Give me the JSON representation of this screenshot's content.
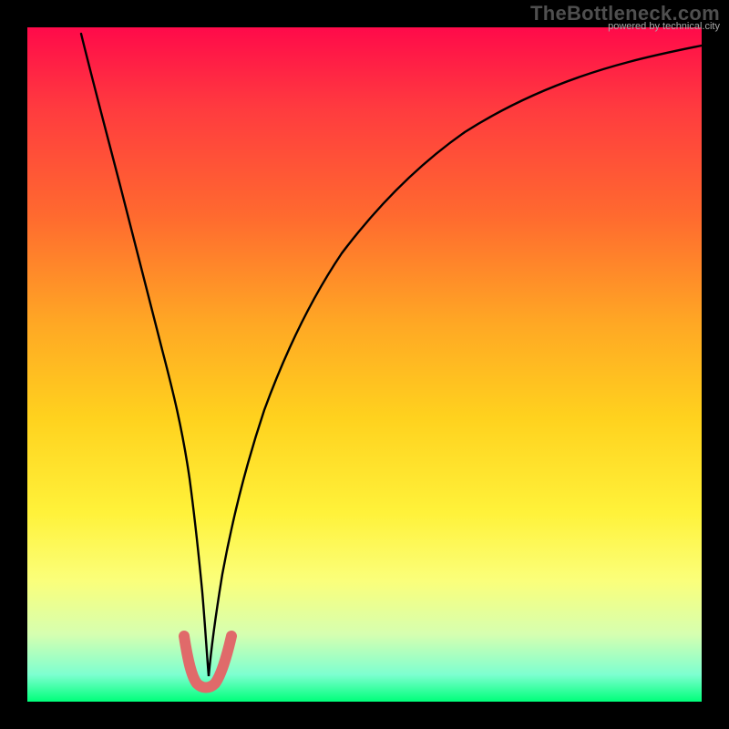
{
  "watermark": {
    "title": "TheBottleneck.com",
    "subtitle": "powered by technical.city"
  },
  "chart_data": {
    "type": "line",
    "title": "",
    "xlabel": "",
    "ylabel": "",
    "xlim": [
      0,
      100
    ],
    "ylim": [
      0,
      100
    ],
    "description": "Red-to-green vertical gradient background with a V-shaped black curve reaching zero near x≈27; short salmon-colored U marker at the minimum.",
    "series": [
      {
        "name": "black-curve",
        "color": "#000000",
        "x": [
          8,
          10,
          12,
          14,
          16,
          18,
          20,
          22,
          23.5,
          25,
          26,
          27,
          28,
          29,
          31,
          34,
          38,
          42,
          46,
          50,
          55,
          60,
          65,
          70,
          75,
          80,
          85,
          90,
          95,
          100
        ],
        "y": [
          99,
          90,
          80,
          71,
          62,
          53,
          44,
          34,
          25,
          16,
          9,
          3,
          6,
          11,
          20,
          30,
          40,
          48,
          55,
          60,
          66,
          71,
          75,
          79,
          82,
          85,
          87.5,
          90,
          92,
          94
        ]
      },
      {
        "name": "salmon-marker",
        "color": "#e06a6a",
        "x": [
          23.5,
          24.5,
          25.5,
          26.5,
          27.5,
          28.5,
          29.5,
          30.7
        ],
        "y": [
          9.5,
          5.8,
          3.0,
          2.2,
          2.2,
          3.0,
          5.5,
          9.5
        ]
      }
    ]
  }
}
